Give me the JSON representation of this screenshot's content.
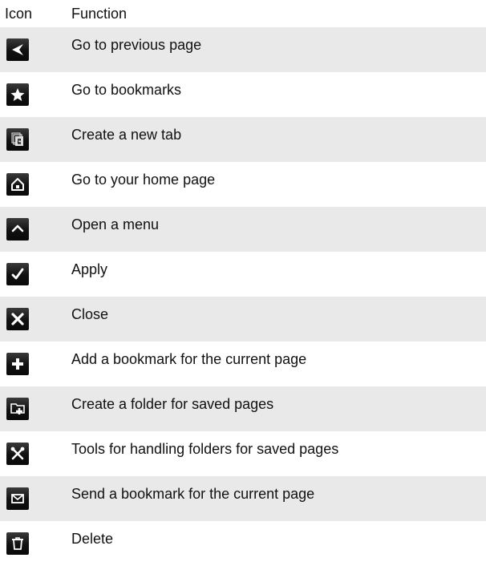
{
  "table": {
    "header": {
      "icon": "Icon",
      "function": "Function"
    },
    "rows": [
      {
        "icon": "back-arrow-icon",
        "label": "Go to previous page"
      },
      {
        "icon": "star-icon",
        "label": "Go to bookmarks"
      },
      {
        "icon": "new-tab-icon",
        "label": "Create a new tab"
      },
      {
        "icon": "home-icon",
        "label": "Go to your home page"
      },
      {
        "icon": "chevron-up-icon",
        "label": "Open a menu"
      },
      {
        "icon": "checkmark-icon",
        "label": "Apply"
      },
      {
        "icon": "close-icon",
        "label": "Close"
      },
      {
        "icon": "plus-icon",
        "label": "Add a bookmark for the current page"
      },
      {
        "icon": "add-folder-icon",
        "label": "Create a folder for saved pages"
      },
      {
        "icon": "tools-icon",
        "label": "Tools for handling folders for saved pages"
      },
      {
        "icon": "envelope-icon",
        "label": "Send a bookmark for the current page"
      },
      {
        "icon": "trash-icon",
        "label": "Delete"
      }
    ]
  }
}
